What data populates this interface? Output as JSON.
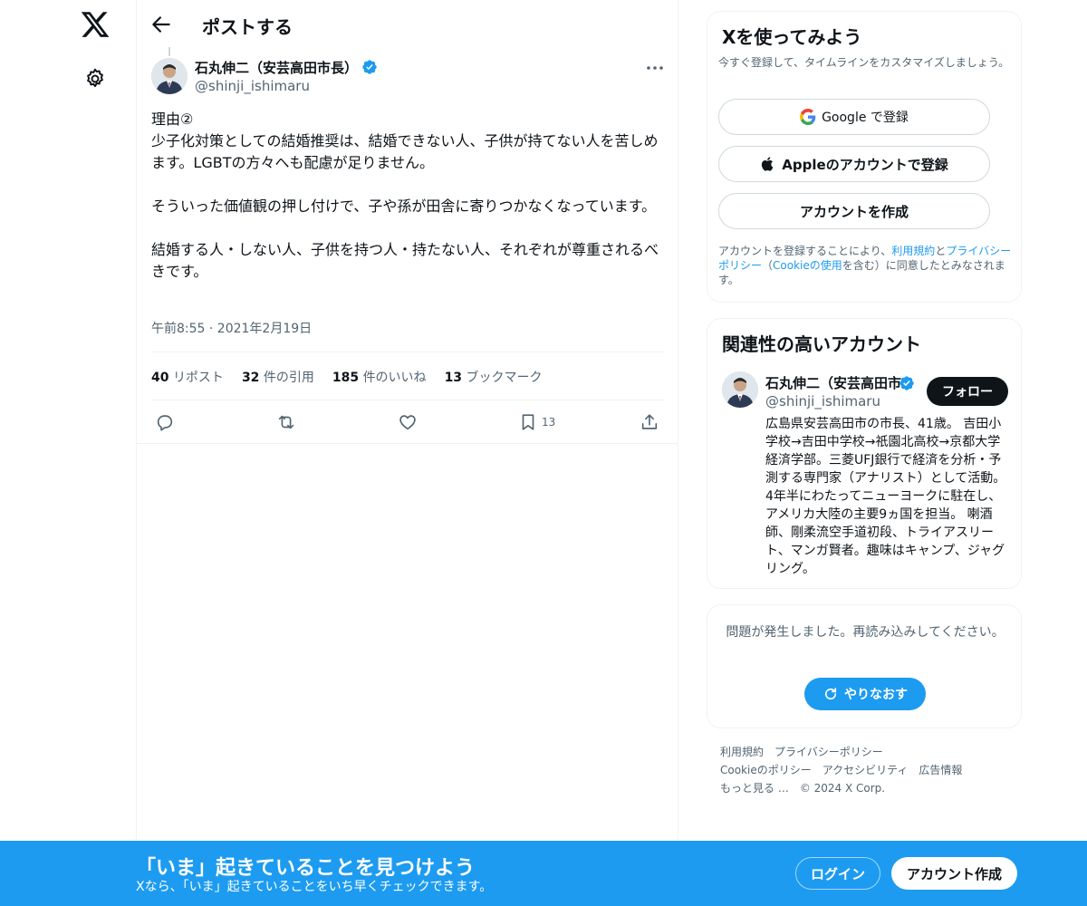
{
  "nav": {
    "logo_icon": "x-logo-icon",
    "settings_icon": "gear-icon"
  },
  "header": {
    "title": "ポストする",
    "back_icon": "arrow-left-icon"
  },
  "post": {
    "author_name": "石丸伸二（安芸高田市長）",
    "author_handle": "@shinji_ishimaru",
    "body": "理由②\n少子化対策としての結婚推奨は、結婚できない人、子供が持てない人を苦しめます。LGBTの方々へも配慮が足りません。\n\nそういった価値観の押し付けで、子や孫が田舎に寄りつかなくなっています。\n\n結婚する人・しない人、子供を持つ人・持たない人、それぞれが尊重されるべきです。",
    "timestamp": "午前8:55 · 2021年2月19日",
    "stats": [
      {
        "count": "40",
        "label": "リポスト"
      },
      {
        "count": "32",
        "label": "件の引用"
      },
      {
        "count": "185",
        "label": "件のいいね"
      },
      {
        "count": "13",
        "label": "ブックマーク"
      }
    ],
    "bookmark_count": "13"
  },
  "signup": {
    "title": "Xを使ってみよう",
    "subtitle": "今すぐ登録して、タイムラインをカスタマイズしましょう。",
    "google_label": "Google で登録",
    "apple_label": "Appleのアカウントで登録",
    "create_label": "アカウントを作成",
    "legal_prefix": "アカウントを登録することにより、",
    "legal_terms": "利用規約",
    "legal_and": "と",
    "legal_privacy": "プライバシーポリシー",
    "legal_paren_open": "（",
    "legal_cookie": "Cookieの使用",
    "legal_suffix": "を含む）に同意したとみなされます。"
  },
  "related": {
    "title": "関連性の高いアカウント",
    "name": "石丸伸二（安芸高田市長）",
    "handle": "@shinji_ishimaru",
    "follow_label": "フォロー",
    "bio": "広島県安芸高田市の市長、41歳。 吉田小学校→吉田中学校→祇園北高校→京都大学経済学部。三菱UFJ銀行で経済を分析・予測する専門家（アナリスト）として活動。4年半にわたってニューヨークに駐在し、アメリカ大陸の主要9ヵ国を担当。 喇酒師、剛柔流空手道初段、トライアスリート、マンガ賢者。趣味はキャンプ、ジャグリング。"
  },
  "error": {
    "message": "問題が発生しました。再読み込みしてください。",
    "retry_label": "やりなおす"
  },
  "footer": {
    "links": [
      "利用規約",
      "プライバシーポリシー",
      "Cookieのポリシー",
      "アクセシビリティ",
      "広告情報",
      "もっと見る …"
    ],
    "copyright": "© 2024 X Corp."
  },
  "banner": {
    "title": "「いま」起きていることを見つけよう",
    "subtitle": "Xなら、「いま」起きていることをいち早くチェックできます。",
    "login_label": "ログイン",
    "create_label": "アカウント作成"
  },
  "colors": {
    "accent": "#1d9bf0",
    "text": "#0f1419",
    "muted": "#536471",
    "border": "#eff3f4"
  }
}
